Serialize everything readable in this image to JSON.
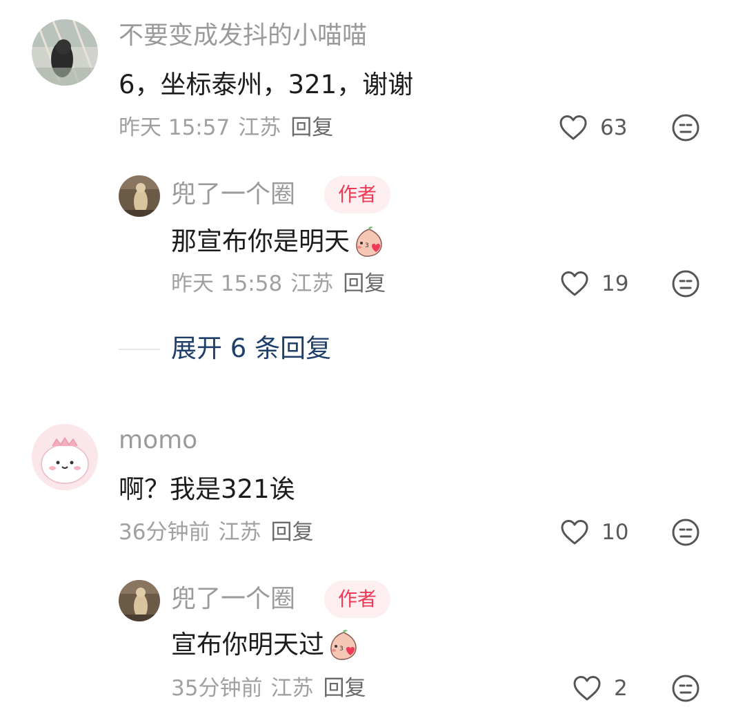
{
  "comments": [
    {
      "username": "不要变成发抖的小喵喵",
      "text": "6，坐标泰州，321，谢谢",
      "time": "昨天 15:57",
      "location": "江苏",
      "reply_label": "回复",
      "likes": "63",
      "replies": [
        {
          "username": "兜了一个圈",
          "badge": "作者",
          "text": "那宣布你是明天",
          "time": "昨天 15:58",
          "location": "江苏",
          "reply_label": "回复",
          "likes": "19",
          "emoji": "peach-blush-emoji"
        }
      ],
      "expand_label": "展开 6 条回复"
    },
    {
      "username": "momo",
      "text": "啊？我是321诶",
      "time": "36分钟前",
      "location": "江苏",
      "reply_label": "回复",
      "likes": "10",
      "replies": [
        {
          "username": "兜了一个圈",
          "badge": "作者",
          "text": "宣布你明天过",
          "time": "35分钟前",
          "location": "江苏",
          "reply_label": "回复",
          "likes": "2",
          "emoji": "peach-blush-emoji"
        }
      ]
    }
  ],
  "icons": {
    "like": "heart-outline-icon",
    "dislike": "neutral-face-icon"
  },
  "colors": {
    "author_badge_bg": "#fdeef0",
    "author_badge_text": "#ef3a57",
    "expand_link": "#1f3f6b"
  }
}
